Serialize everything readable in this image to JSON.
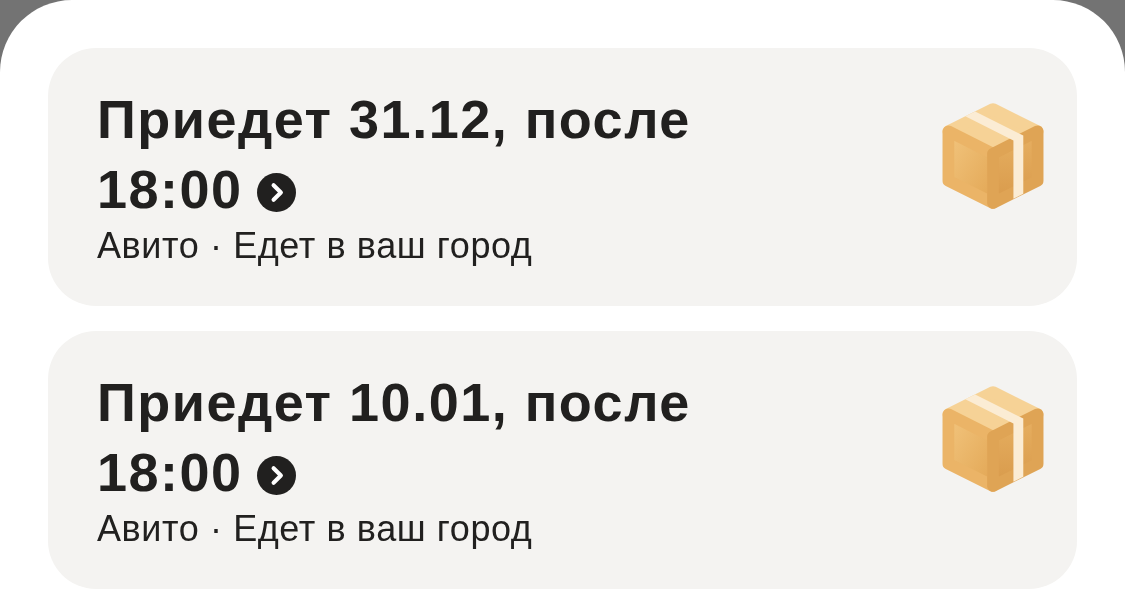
{
  "deliveries": [
    {
      "title": "Приедет 31.12, после",
      "time": "18:00",
      "subtitle": "Авито · Едет в ваш город"
    },
    {
      "title": "Приедет 10.01, после",
      "time": "18:00",
      "subtitle": "Авито · Едет в ваш город"
    }
  ]
}
